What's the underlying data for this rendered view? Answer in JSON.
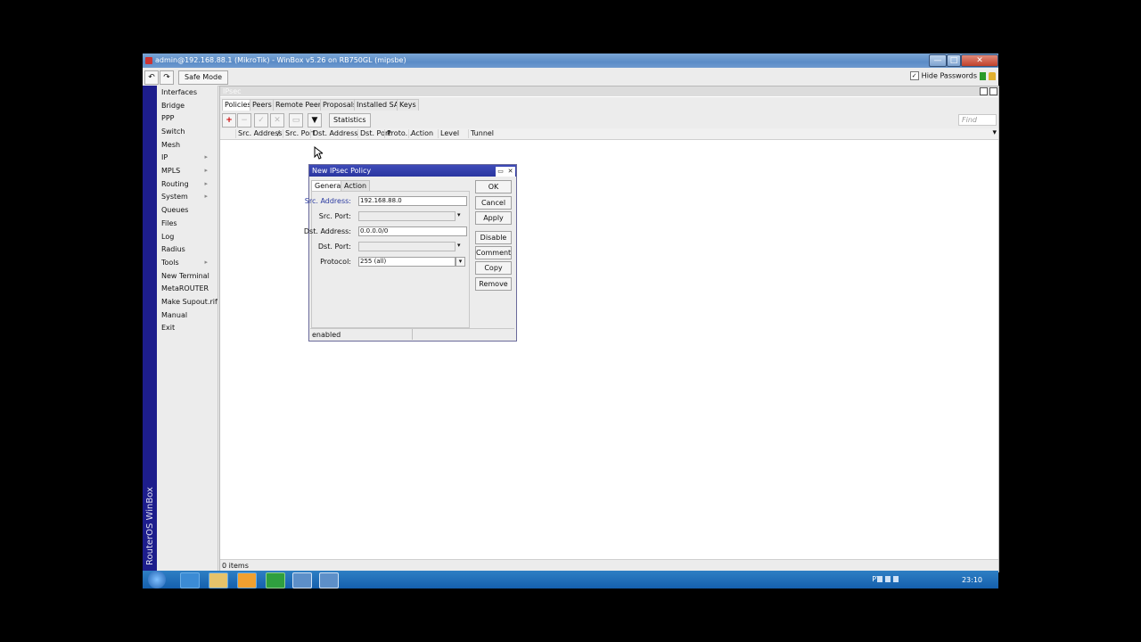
{
  "window": {
    "title": "admin@192.168.88.1 (MikroTik) - WinBox v5.26 on RB750GL (mipsbe)",
    "controls": {
      "minimize": "—",
      "maximize": "□",
      "close": "✕"
    }
  },
  "toolbar": {
    "undo": "↶",
    "redo": "↷",
    "safe_mode": "Safe Mode",
    "hide_passwords": "Hide Passwords",
    "hide_passwords_checked": "✓"
  },
  "sidebar": {
    "vertical_label": "RouterOS WinBox",
    "items": [
      {
        "label": "Interfaces",
        "arrow": ""
      },
      {
        "label": "Bridge",
        "arrow": ""
      },
      {
        "label": "PPP",
        "arrow": ""
      },
      {
        "label": "Switch",
        "arrow": ""
      },
      {
        "label": "Mesh",
        "arrow": ""
      },
      {
        "label": "IP",
        "arrow": "▸"
      },
      {
        "label": "MPLS",
        "arrow": "▸"
      },
      {
        "label": "Routing",
        "arrow": "▸"
      },
      {
        "label": "System",
        "arrow": "▸"
      },
      {
        "label": "Queues",
        "arrow": ""
      },
      {
        "label": "Files",
        "arrow": ""
      },
      {
        "label": "Log",
        "arrow": ""
      },
      {
        "label": "Radius",
        "arrow": ""
      },
      {
        "label": "Tools",
        "arrow": "▸"
      },
      {
        "label": "New Terminal",
        "arrow": ""
      },
      {
        "label": "MetaROUTER",
        "arrow": ""
      },
      {
        "label": "Make Supout.rif",
        "arrow": ""
      },
      {
        "label": "Manual",
        "arrow": ""
      },
      {
        "label": "Exit",
        "arrow": ""
      }
    ]
  },
  "ipsec": {
    "title": "IPsec",
    "tabs": [
      "Policies",
      "Peers",
      "Remote Peers",
      "Proposals",
      "Installed SAs",
      "Keys"
    ],
    "tools": {
      "add": "+",
      "remove": "−",
      "enable": "✓",
      "disable": "✕",
      "comment": "▭",
      "filter": "▼",
      "statistics": "Statistics"
    },
    "find_placeholder": "Find",
    "columns": [
      "Src. Address",
      "/",
      "Src. Port",
      "Dst. Address",
      "Dst. Port",
      "Proto...",
      "Action",
      "Level",
      "Tunnel"
    ],
    "column_menu": "▾",
    "status": "0 items"
  },
  "dialog": {
    "title": "New IPsec Policy",
    "tabs": [
      "General",
      "Action"
    ],
    "fields": {
      "src_address": {
        "label": "Src. Address:",
        "value": "192.168.88.0"
      },
      "src_port": {
        "label": "Src. Port:",
        "value": ""
      },
      "dst_address": {
        "label": "Dst. Address:",
        "value": "0.0.0.0/0"
      },
      "dst_port": {
        "label": "Dst. Port:",
        "value": ""
      },
      "protocol": {
        "label": "Protocol:",
        "value": "255 (all)"
      }
    },
    "dropdown_arrow": "▾",
    "buttons": [
      "OK",
      "Cancel",
      "Apply",
      "Disable",
      "Comment",
      "Copy",
      "Remove"
    ],
    "status": "enabled"
  },
  "taskbar": {
    "language": "PT",
    "time": "23:10"
  }
}
